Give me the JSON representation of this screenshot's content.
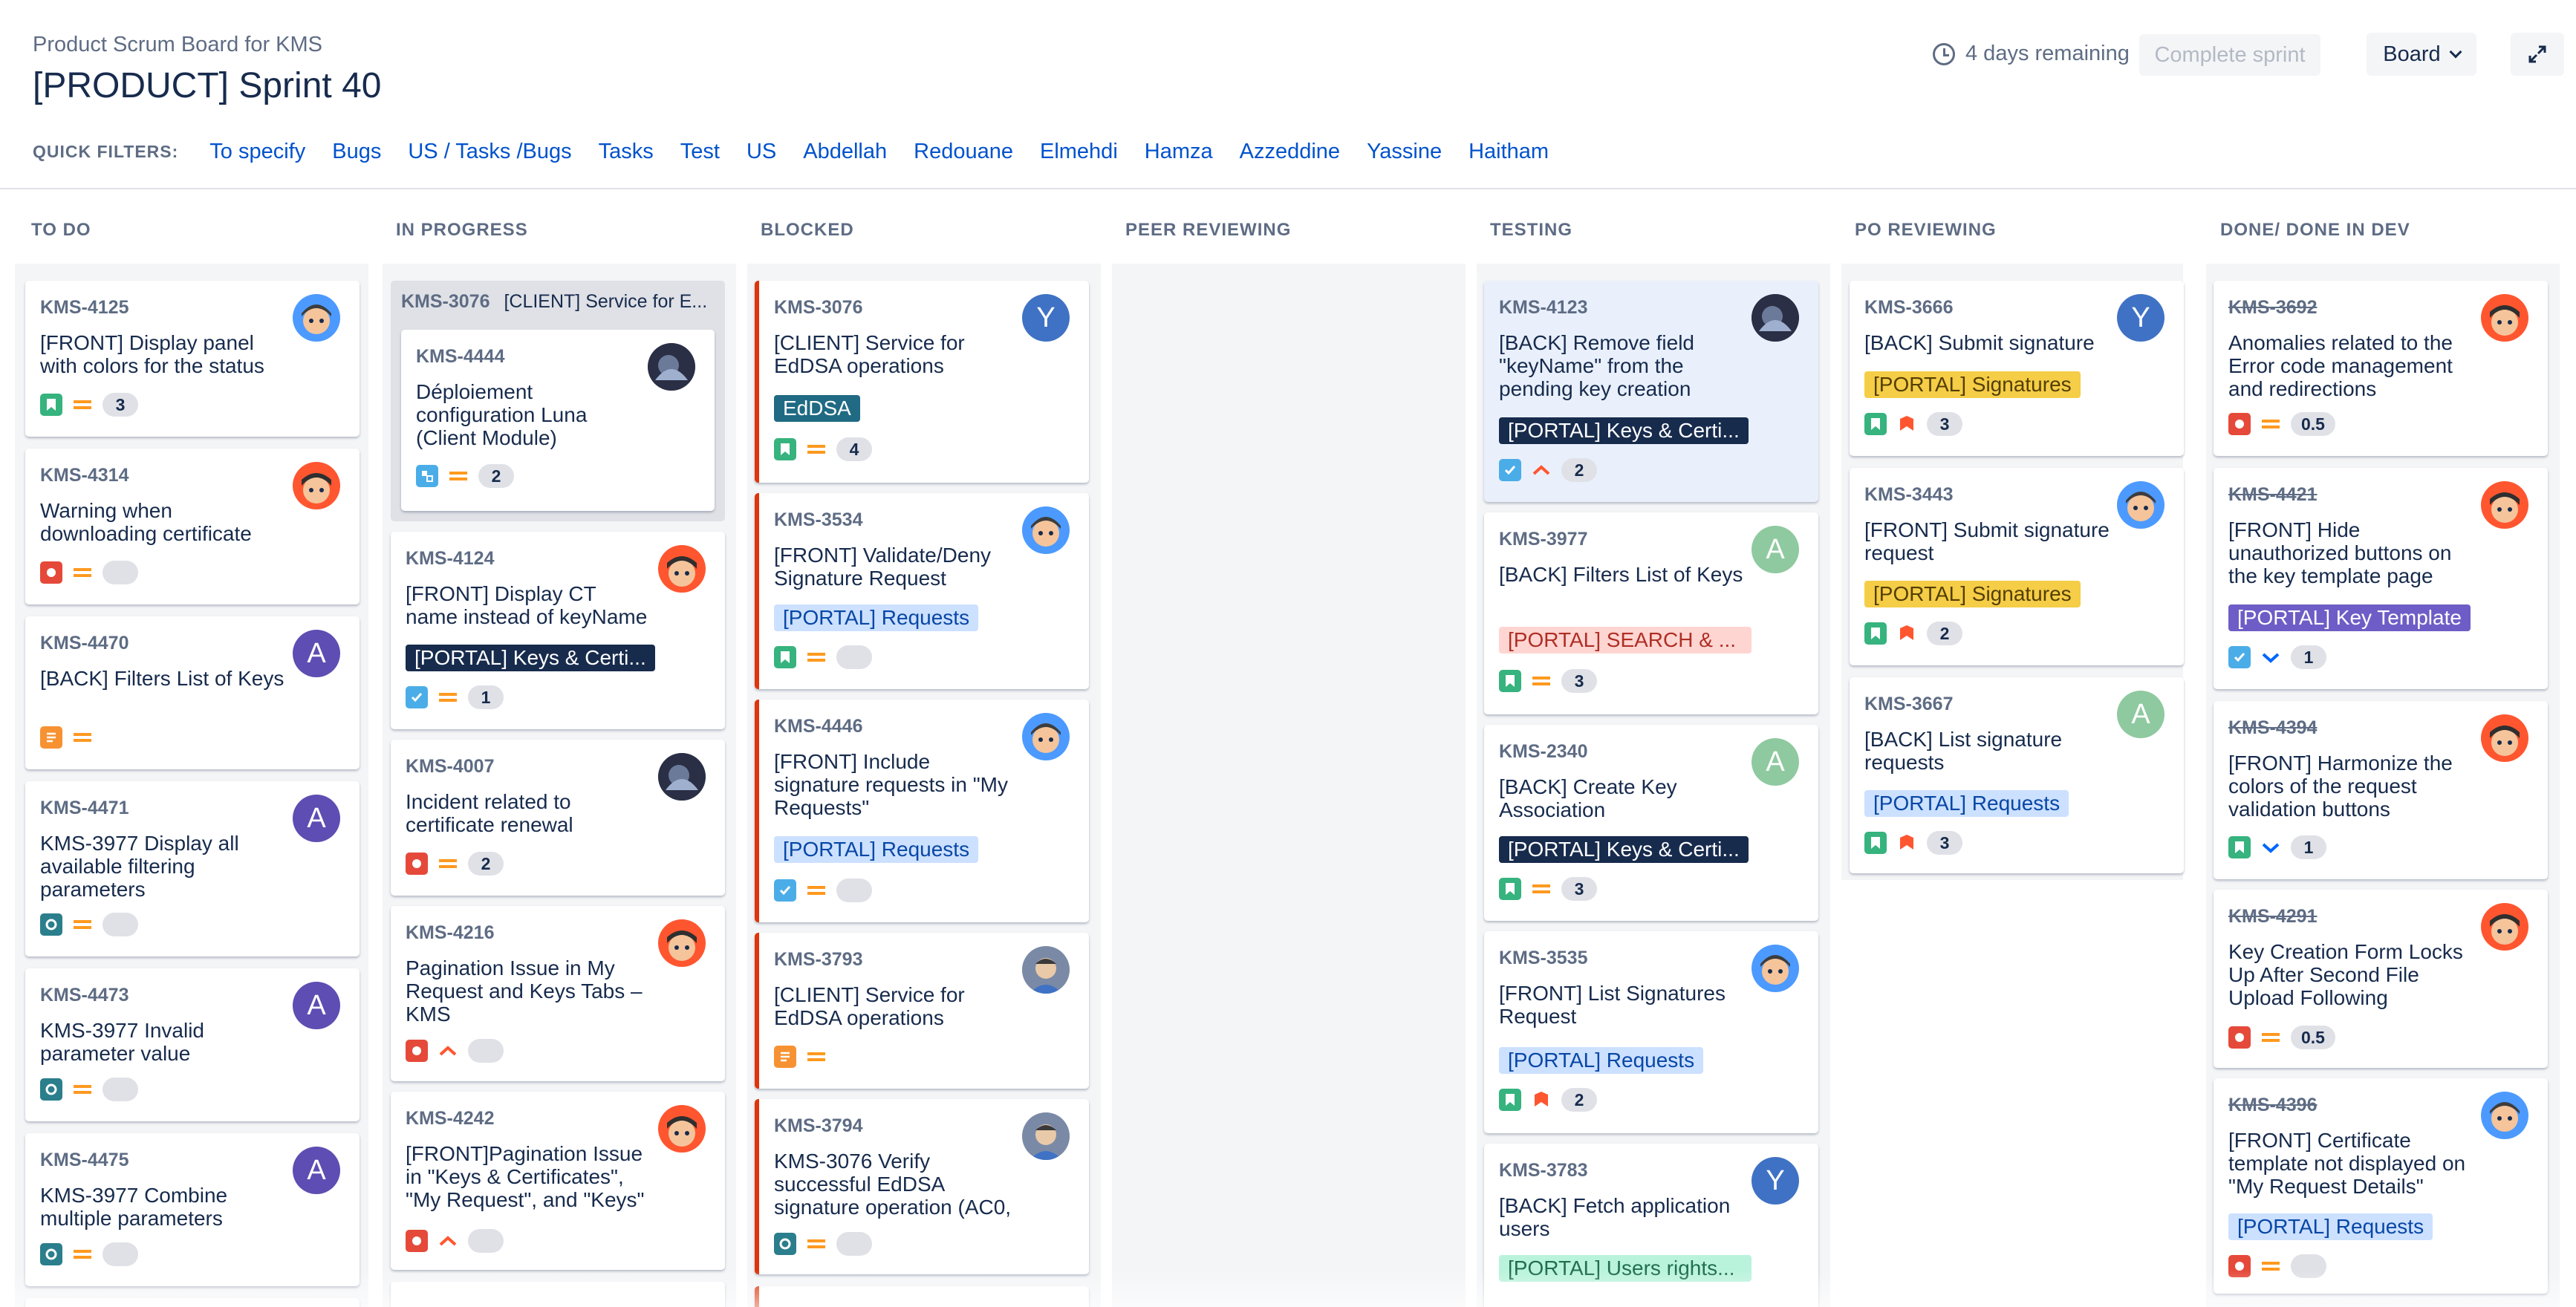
{
  "header": {
    "subtitle": "Product Scrum Board for KMS",
    "title": "[PRODUCT] Sprint 40",
    "remaining": "4 days remaining",
    "complete_label": "Complete sprint",
    "board_label": "Board"
  },
  "filters": {
    "label": "QUICK FILTERS:",
    "items": [
      "To specify",
      "Bugs",
      "US / Tasks /Bugs",
      "Tasks",
      "Test",
      "US",
      "Abdellah",
      "Redouane",
      "Elmehdi",
      "Hamza",
      "Azzeddine",
      "Yassine",
      "Haitham"
    ]
  },
  "columns": [
    {
      "name": "TO DO"
    },
    {
      "name": "IN PROGRESS"
    },
    {
      "name": "BLOCKED"
    },
    {
      "name": "PEER REVIEWING"
    },
    {
      "name": "TESTING"
    },
    {
      "name": "PO REVIEWING"
    },
    {
      "name": "DONE/ DONE IN DEV"
    }
  ],
  "colors": {
    "story": "#36b37e",
    "bug": "#e5493a",
    "task": "#4bade8",
    "improvement": "#f79232",
    "test": "#2b7e8c",
    "priority_medium": "#ff991f",
    "priority_high": "#ff5630",
    "priority_low": "#0065ff",
    "label_dark": "#172b4d",
    "label_blue": "#cce0ff",
    "label_yellow": "#f8e6a0",
    "label_red": "#ffd5d2",
    "label_green": "#baf3db",
    "label_purple": "#8f7ee7",
    "label_teal": "#206a83"
  },
  "cards": {
    "c1": {
      "key": "KMS-4125",
      "summary": "[FRONT] Display panel with colors for the status",
      "type": "story-icon",
      "priority": "priority-medium-icon",
      "points": "3"
    },
    "c2": {
      "key": "KMS-4314",
      "summary": "Warning when downloading certificate",
      "type": "bug-icon",
      "priority": "priority-medium-icon",
      "points": ""
    },
    "c3": {
      "key": "KMS-4470",
      "summary": "[BACK] Filters List of Keys",
      "type": "improvement-icon",
      "priority": "priority-medium-icon",
      "avatar": "A"
    },
    "c4": {
      "key": "KMS-4471",
      "summary": "KMS-3977 Display all available filtering parameters",
      "type": "test-icon",
      "priority": "priority-medium-icon",
      "points": "",
      "avatar": "A"
    },
    "c5": {
      "key": "KMS-4473",
      "summary": "KMS-3977 Invalid parameter value",
      "type": "test-icon",
      "priority": "priority-medium-icon",
      "points": "",
      "avatar": "A"
    },
    "c6": {
      "key": "KMS-4475",
      "summary": "KMS-3977 Combine multiple parameters",
      "type": "test-icon",
      "priority": "priority-medium-icon",
      "points": "",
      "avatar": "A"
    },
    "p0": {
      "parent": "KMS-3076",
      "parent_summary": "[CLIENT] Service for E...",
      "key": "KMS-4444",
      "summary": "Déploiement configuration Luna (Client Module)",
      "type": "subtask-icon",
      "priority": "priority-medium-icon",
      "points": "2"
    },
    "p1": {
      "key": "KMS-4124",
      "summary": "[FRONT] Display CT name instead of keyName",
      "label": "[PORTAL] Keys & Certi...",
      "type": "task-icon",
      "priority": "priority-medium-icon",
      "points": "1"
    },
    "p2": {
      "key": "KMS-4007",
      "summary": "Incident related to certificate renewal",
      "type": "bug-icon",
      "priority": "priority-medium-icon",
      "points": "2"
    },
    "p3": {
      "key": "KMS-4216",
      "summary": "Pagination Issue in My Request and Keys Tabs – KMS",
      "type": "bug-icon",
      "priority": "priority-high-icon",
      "points": ""
    },
    "p4": {
      "key": "KMS-4242",
      "summary": "[FRONT]Pagination Issue in \"Keys & Certificates\", \"My Request\", and \"Keys\"",
      "type": "bug-icon",
      "priority": "priority-high-icon",
      "points": ""
    },
    "b1": {
      "key": "KMS-3076",
      "summary": "[CLIENT] Service for EdDSA operations",
      "label": "EdDSA",
      "type": "story-icon",
      "priority": "priority-medium-icon",
      "points": "4",
      "avatar": "Y"
    },
    "b2": {
      "key": "KMS-3534",
      "summary": "[FRONT] Validate/Deny Signature Request",
      "label": "[PORTAL] Requests",
      "type": "story-icon",
      "priority": "priority-medium-icon",
      "points": ""
    },
    "b3": {
      "key": "KMS-4446",
      "summary": "[FRONT] Include signature requests in \"My Requests\"",
      "label": "[PORTAL] Requests",
      "type": "task-icon",
      "priority": "priority-medium-icon",
      "points": ""
    },
    "b4": {
      "key": "KMS-3793",
      "summary": "[CLIENT] Service for EdDSA operations",
      "type": "improvement-icon",
      "priority": "priority-medium-icon"
    },
    "b5": {
      "key": "KMS-3794",
      "summary": "KMS-3076 Verify successful EdDSA signature operation (AC0,",
      "type": "test-icon",
      "priority": "priority-medium-icon",
      "points": ""
    },
    "t1": {
      "key": "KMS-4123",
      "summary": "[BACK] Remove field \"keyName\" from the pending key creation",
      "label": "[PORTAL] Keys & Certi...",
      "type": "task-icon",
      "priority": "priority-high-icon",
      "points": "2"
    },
    "t2": {
      "key": "KMS-3977",
      "summary": "[BACK] Filters List of Keys",
      "label": "[PORTAL] SEARCH & ...",
      "type": "story-icon",
      "priority": "priority-medium-icon",
      "points": "3",
      "avatar": "A"
    },
    "t3": {
      "key": "KMS-2340",
      "summary": "[BACK] Create Key Association",
      "label": "[PORTAL] Keys & Certi...",
      "type": "story-icon",
      "priority": "priority-medium-icon",
      "points": "3",
      "avatar": "A"
    },
    "t4": {
      "key": "KMS-3535",
      "summary": "[FRONT] List Signatures Request",
      "label": "[PORTAL] Requests",
      "type": "story-icon",
      "priority": "priority-highest-icon",
      "points": "2"
    },
    "t5": {
      "key": "KMS-3783",
      "summary": "[BACK] Fetch application users",
      "label": "[PORTAL] Users rights...",
      "avatar": "Y"
    },
    "r1": {
      "key": "KMS-3666",
      "summary": "[BACK] Submit signature",
      "label": "[PORTAL] Signatures",
      "type": "story-icon",
      "priority": "priority-highest-icon",
      "points": "3",
      "avatar": "Y"
    },
    "r2": {
      "key": "KMS-3443",
      "summary": "[FRONT] Submit signature request",
      "label": "[PORTAL] Signatures",
      "type": "story-icon",
      "priority": "priority-highest-icon",
      "points": "2"
    },
    "r3": {
      "key": "KMS-3667",
      "summary": "[BACK] List signature requests",
      "label": "[PORTAL] Requests",
      "type": "story-icon",
      "priority": "priority-highest-icon",
      "points": "3",
      "avatar": "A"
    },
    "d1": {
      "key": "KMS-3692",
      "summary": "Anomalies related to the Error code management and redirections",
      "type": "bug-icon",
      "priority": "priority-medium-icon",
      "points": "0.5"
    },
    "d2": {
      "key": "KMS-4421",
      "summary": "[FRONT] Hide unauthorized buttons on the key template page",
      "label": "[PORTAL] Key Template",
      "type": "task-icon",
      "priority": "priority-low-icon",
      "points": "1"
    },
    "d3": {
      "key": "KMS-4394",
      "summary": "[FRONT] Harmonize the colors of the request validation buttons",
      "type": "story-icon",
      "priority": "priority-low-icon",
      "points": "1"
    },
    "d4": {
      "key": "KMS-4291",
      "summary": "Key Creation Form Locks Up After Second File Upload Following",
      "type": "bug-icon",
      "priority": "priority-medium-icon",
      "points": "0.5"
    },
    "d5": {
      "key": "KMS-4396",
      "summary": "[FRONT] Certificate template not displayed on \"My Request Details\"",
      "label": "[PORTAL] Requests",
      "type": "bug-icon",
      "priority": "priority-medium-icon",
      "points": ""
    }
  }
}
